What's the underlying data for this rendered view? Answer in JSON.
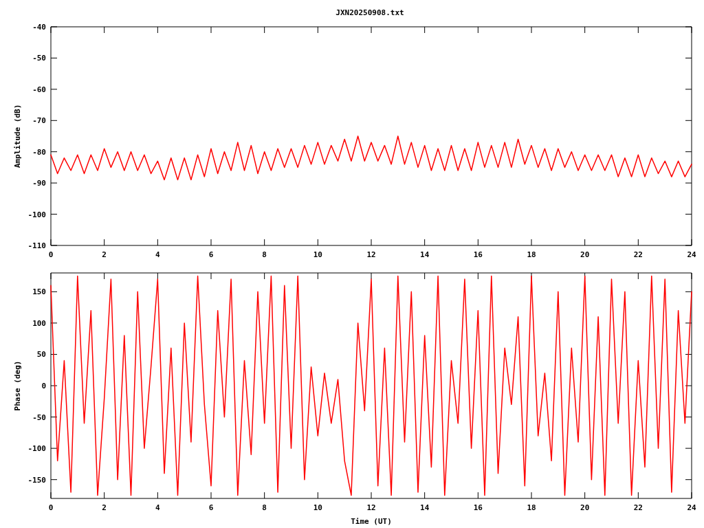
{
  "title": "JXN20250908.txt",
  "charts": [
    {
      "chart_data": {
        "type": "line",
        "ylabel": "Amplitude (dB)",
        "xlim": [
          0,
          24
        ],
        "ylim": [
          -110,
          -40
        ],
        "xticks": [
          0,
          2,
          4,
          6,
          8,
          10,
          12,
          14,
          16,
          18,
          20,
          22,
          24
        ],
        "yticks": [
          -40,
          -50,
          -60,
          -70,
          -80,
          -90,
          -100,
          -110
        ],
        "x": [
          0,
          0.25,
          0.5,
          0.75,
          1,
          1.25,
          1.5,
          1.75,
          2,
          2.25,
          2.5,
          2.75,
          3,
          3.25,
          3.5,
          3.75,
          4,
          4.25,
          4.5,
          4.75,
          5,
          5.25,
          5.5,
          5.75,
          6,
          6.25,
          6.5,
          6.75,
          7,
          7.25,
          7.5,
          7.75,
          8,
          8.25,
          8.5,
          8.75,
          9,
          9.25,
          9.5,
          9.75,
          10,
          10.25,
          10.5,
          10.75,
          11,
          11.25,
          11.5,
          11.75,
          12,
          12.25,
          12.5,
          12.75,
          13,
          13.25,
          13.5,
          13.75,
          14,
          14.25,
          14.5,
          14.75,
          15,
          15.25,
          15.5,
          15.75,
          16,
          16.25,
          16.5,
          16.75,
          17,
          17.25,
          17.5,
          17.75,
          18,
          18.25,
          18.5,
          18.75,
          19,
          19.25,
          19.5,
          19.75,
          20,
          20.25,
          20.5,
          20.75,
          21,
          21.25,
          21.5,
          21.75,
          22,
          22.25,
          22.5,
          22.75,
          23,
          23.25,
          23.5,
          23.75,
          24
        ],
        "series": [
          {
            "color": "#ff0000",
            "values": [
              -81,
              -87,
              -82,
              -86,
              -81,
              -87,
              -81,
              -86,
              -79,
              -85,
              -80,
              -86,
              -80,
              -86,
              -81,
              -87,
              -83,
              -89,
              -82,
              -89,
              -82,
              -89,
              -81,
              -88,
              -79,
              -87,
              -80,
              -86,
              -77,
              -86,
              -78,
              -87,
              -80,
              -86,
              -79,
              -85,
              -79,
              -85,
              -78,
              -84,
              -77,
              -84,
              -78,
              -83,
              -76,
              -83,
              -75,
              -83,
              -77,
              -83,
              -78,
              -84,
              -75,
              -84,
              -77,
              -85,
              -78,
              -86,
              -79,
              -86,
              -78,
              -86,
              -79,
              -86,
              -77,
              -85,
              -78,
              -85,
              -77,
              -85,
              -76,
              -84,
              -78,
              -85,
              -79,
              -86,
              -79,
              -85,
              -80,
              -86,
              -81,
              -86,
              -81,
              -86,
              -81,
              -88,
              -82,
              -88,
              -81,
              -88,
              -82,
              -87,
              -83,
              -88,
              -83,
              -88,
              -84
            ]
          }
        ]
      }
    },
    {
      "chart_data": {
        "type": "line",
        "xlabel": "Time (UT)",
        "ylabel": "Phase (deg)",
        "xlim": [
          0,
          24
        ],
        "ylim": [
          -180,
          180
        ],
        "xticks": [
          0,
          2,
          4,
          6,
          8,
          10,
          12,
          14,
          16,
          18,
          20,
          22,
          24
        ],
        "yticks": [
          150,
          100,
          50,
          0,
          -50,
          -100,
          -150
        ],
        "x": [
          0,
          0.25,
          0.5,
          0.75,
          1,
          1.25,
          1.5,
          1.75,
          2,
          2.25,
          2.5,
          2.75,
          3,
          3.25,
          3.5,
          3.75,
          4,
          4.25,
          4.5,
          4.75,
          5,
          5.25,
          5.5,
          5.75,
          6,
          6.25,
          6.5,
          6.75,
          7,
          7.25,
          7.5,
          7.75,
          8,
          8.25,
          8.5,
          8.75,
          9,
          9.25,
          9.5,
          9.75,
          10,
          10.25,
          10.5,
          10.75,
          11,
          11.25,
          11.5,
          11.75,
          12,
          12.25,
          12.5,
          12.75,
          13,
          13.25,
          13.5,
          13.75,
          14,
          14.25,
          14.5,
          14.75,
          15,
          15.25,
          15.5,
          15.75,
          16,
          16.25,
          16.5,
          16.75,
          17,
          17.25,
          17.5,
          17.75,
          18,
          18.25,
          18.5,
          18.75,
          19,
          19.25,
          19.5,
          19.75,
          20,
          20.25,
          20.5,
          20.75,
          21,
          21.25,
          21.5,
          21.75,
          22,
          22.25,
          22.5,
          22.75,
          23,
          23.25,
          23.5,
          23.75,
          24
        ],
        "series": [
          {
            "color": "#ff0000",
            "values": [
              160,
              -120,
              40,
              -170,
              175,
              -60,
              120,
              -175,
              -20,
              170,
              -150,
              80,
              -175,
              150,
              -100,
              30,
              170,
              -140,
              60,
              -175,
              100,
              -90,
              175,
              -30,
              -160,
              120,
              -50,
              170,
              -175,
              40,
              -110,
              150,
              -60,
              175,
              -170,
              160,
              -100,
              175,
              -150,
              30,
              -80,
              20,
              -60,
              10,
              -120,
              -175,
              100,
              -40,
              170,
              -160,
              60,
              -175,
              175,
              -90,
              150,
              -170,
              80,
              -130,
              175,
              -175,
              40,
              -60,
              170,
              -100,
              120,
              -175,
              175,
              -140,
              60,
              -30,
              110,
              -160,
              175,
              -80,
              20,
              -120,
              150,
              -175,
              60,
              -90,
              175,
              -150,
              110,
              -175,
              170,
              -60,
              150,
              -175,
              40,
              -130,
              175,
              -100,
              170,
              -170,
              120,
              -60,
              150
            ]
          }
        ]
      }
    }
  ]
}
